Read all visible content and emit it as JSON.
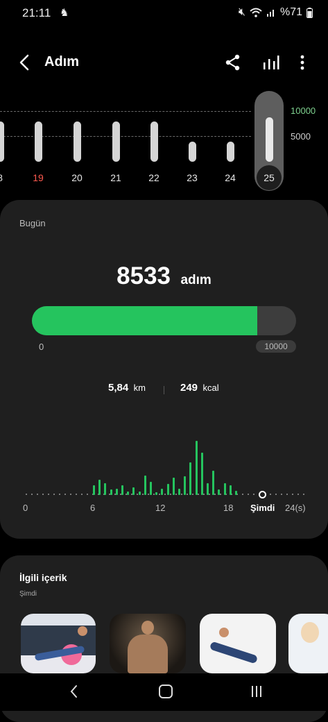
{
  "status": {
    "time": "21:11",
    "battery": "%71"
  },
  "header": {
    "title": "Adım"
  },
  "week": {
    "days": [
      "8",
      "19",
      "20",
      "21",
      "22",
      "23",
      "24",
      "25"
    ],
    "bar_steps": [
      9000,
      9000,
      9000,
      9000,
      9000,
      4500,
      4500,
      8533
    ],
    "highlight_day": "19",
    "selected_day": "25",
    "goal_labels": [
      "10000",
      "5000"
    ]
  },
  "today": {
    "label": "Bugün",
    "steps": "8533",
    "steps_unit": "adım",
    "progress": 0.8533,
    "progress_min": "0",
    "progress_goal": "10000",
    "distance_value": "5,84",
    "distance_unit": "km",
    "calories_value": "249",
    "calories_unit": "kcal",
    "hourly_axis": {
      "ticks": [
        "0",
        "6",
        "12",
        "18"
      ],
      "now_label": "Şimdi",
      "end_label": "24(s)"
    },
    "hourly_bars": [
      0.18,
      0.28,
      0.22,
      0.1,
      0.12,
      0.18,
      0.07,
      0.14,
      0.06,
      0.36,
      0.25,
      0.05,
      0.12,
      0.2,
      0.32,
      0.12,
      0.35,
      0.6,
      1.0,
      0.78,
      0.22,
      0.45,
      0.1,
      0.22,
      0.18,
      0.08
    ]
  },
  "related": {
    "title": "İlgili içerik",
    "subtitle": "Şimdi"
  },
  "colors": {
    "accent": "#25c45e",
    "highlight_day": "#ff5a4f",
    "goal_label": "#7fd28f",
    "card": "#1f1f1f"
  }
}
